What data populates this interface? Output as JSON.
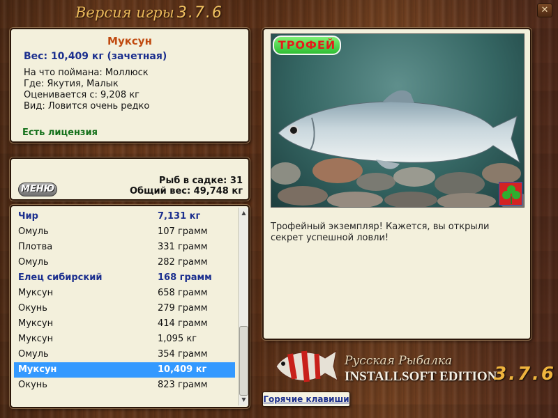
{
  "header": {
    "title": "Версия игры",
    "version": "3.7.6",
    "close_label": "✕"
  },
  "info": {
    "fish_name": "Муксун",
    "weight_line": "Вес: 10,409 кг (зачетная)",
    "lines": [
      "На что поймана: Моллюск",
      "Где: Якутия, Малык",
      "Оценивается с: 9,208 кг",
      "Вид: Ловится очень редко"
    ],
    "license": "Есть лицензия"
  },
  "stats": {
    "menu_label": "МЕНЮ",
    "fish_in_cage": "Рыб в садке: 31",
    "total_weight": "Общий вес: 49,748 кг"
  },
  "catch_list": [
    {
      "name": "Чир",
      "weight": "7,131 кг",
      "trophy": true
    },
    {
      "name": "Омуль",
      "weight": "107 грамм",
      "trophy": false
    },
    {
      "name": "Плотва",
      "weight": "331 грамм",
      "trophy": false
    },
    {
      "name": "Омуль",
      "weight": "282 грамм",
      "trophy": false
    },
    {
      "name": "Елец сибирский",
      "weight": "168 грамм",
      "trophy": true
    },
    {
      "name": "Муксун",
      "weight": "658 грамм",
      "trophy": false
    },
    {
      "name": "Окунь",
      "weight": "279 грамм",
      "trophy": false
    },
    {
      "name": "Муксун",
      "weight": "414 грамм",
      "trophy": false
    },
    {
      "name": "Муксун",
      "weight": "1,095 кг",
      "trophy": false
    },
    {
      "name": "Омуль",
      "weight": "354 грамм",
      "trophy": false
    },
    {
      "name": "Муксун",
      "weight": "10,409 кг",
      "trophy": false,
      "selected": true
    },
    {
      "name": "Окунь",
      "weight": "823 грамм",
      "trophy": false
    }
  ],
  "image": {
    "badge": "ТРОФЕЙ",
    "description": "Трофейный экземпляр! Кажется, вы открыли секрет успешной ловли!"
  },
  "logo": {
    "script": "Русская Рыбалка",
    "edition": "INSTALLSOFT EDITION",
    "version": "3.7.6"
  },
  "hotkeys_label": "Горячие клавиши",
  "colors": {
    "panel_bg": "#f3f0dc",
    "trophy_text": "#1b2f8e",
    "fish_name": "#c04a10",
    "license": "#13701a",
    "selection": "#3399ff"
  }
}
